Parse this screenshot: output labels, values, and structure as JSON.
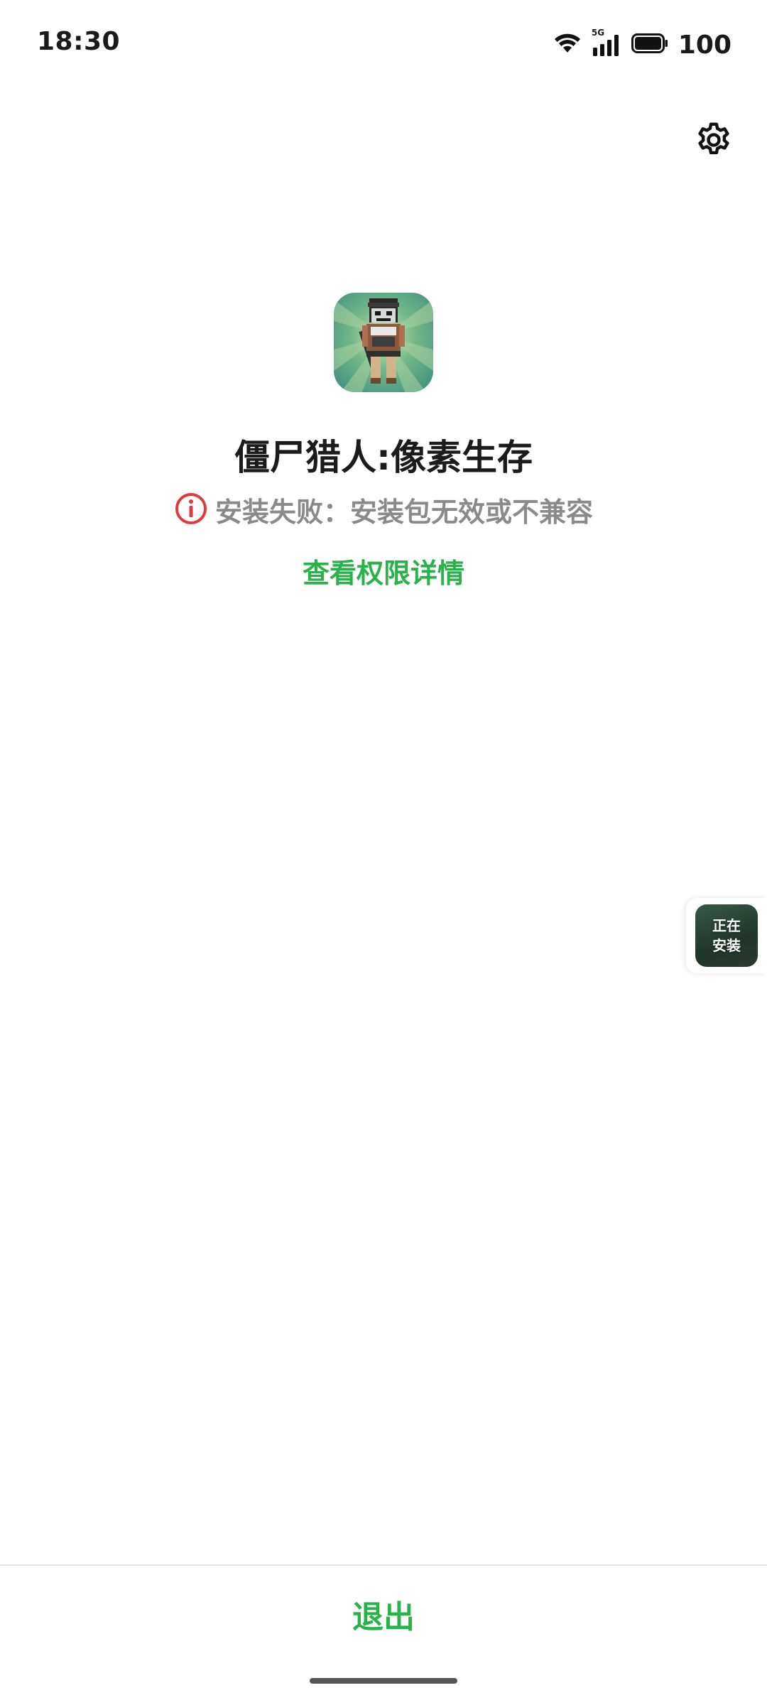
{
  "status_bar": {
    "time": "18:30",
    "network_label": "5G",
    "battery_percent": "100",
    "icons": [
      "wifi-icon",
      "cellular-signal-icon",
      "battery-icon"
    ]
  },
  "header": {
    "settings_icon": "gear-icon"
  },
  "app": {
    "icon": "app-icon",
    "title": "僵尸猎人:像素生存",
    "status_icon": "info-icon",
    "status_text": "安装失败：安装包无效或不兼容",
    "permission_link": "查看权限详情"
  },
  "floating_bubble": {
    "line1": "正在",
    "line2": "安装"
  },
  "footer": {
    "exit_label": "退出"
  },
  "colors": {
    "accent_green": "#2ab24a",
    "error_red": "#e0393e",
    "secondary_text": "#8a8a8a"
  }
}
